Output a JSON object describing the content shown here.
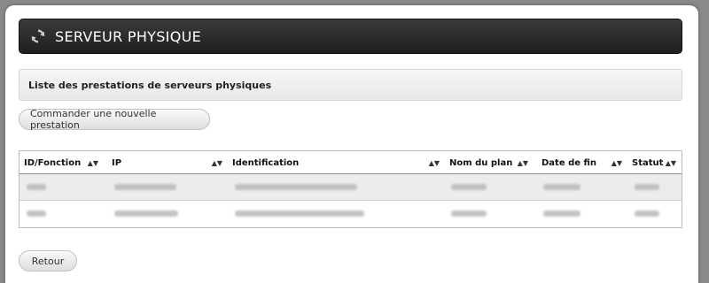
{
  "header": {
    "title": "SERVEUR PHYSIQUE",
    "icon": "refresh-icon"
  },
  "section": {
    "subtitle": "Liste des prestations de serveurs physiques"
  },
  "actions": {
    "new_order_label": "Commander une nouvelle prestation",
    "back_label": "Retour"
  },
  "table": {
    "columns": [
      "ID/Fonction",
      "IP",
      "Identification",
      "Nom du plan",
      "Date de fin",
      "Statut"
    ],
    "sort_icon": "sort-icon",
    "rows_note_blurred": true
  },
  "colors": {
    "titlebar": "#2a2a2a",
    "subhead": "#eeeeee",
    "alt_row": "#ececec"
  }
}
